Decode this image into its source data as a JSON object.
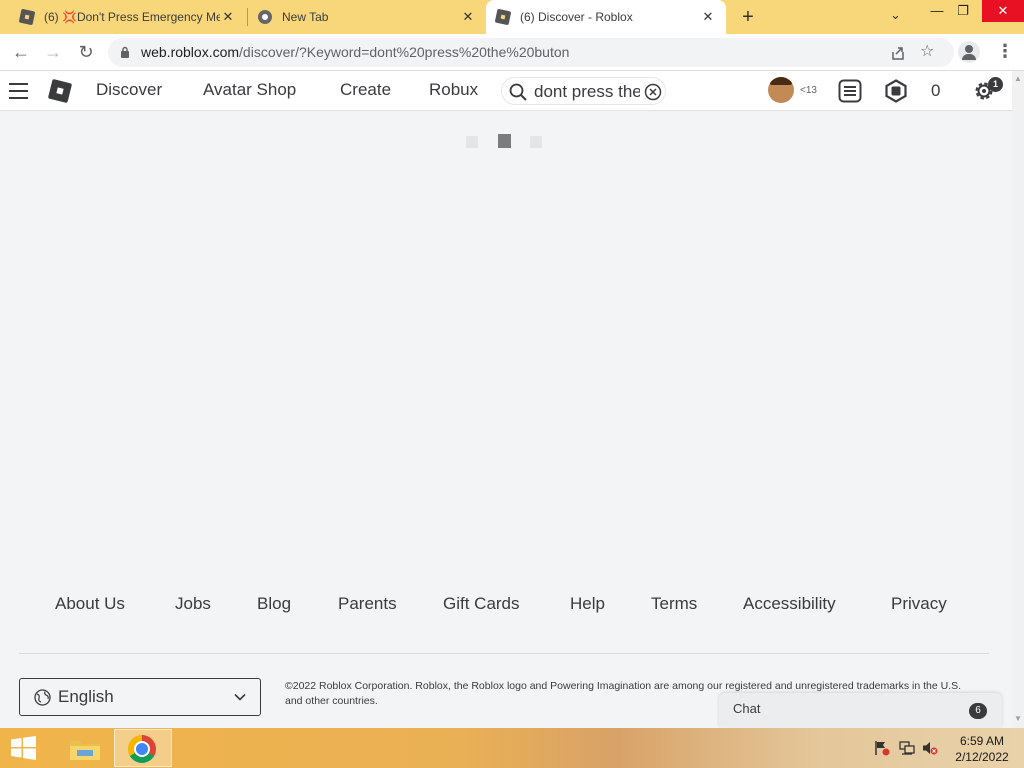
{
  "browser": {
    "tabs": [
      {
        "title": "(6) 💢Don't Press Emergency Me",
        "icon": "roblox-favicon"
      },
      {
        "title": "New Tab",
        "icon": "chrome-favicon"
      },
      {
        "title": "(6) Discover - Roblox",
        "icon": "roblox-favicon"
      }
    ],
    "active_tab": 2,
    "new_tab_label": "+",
    "url_host": "web.roblox.com",
    "url_path": "/discover/?Keyword=dont%20press%20the%20buton"
  },
  "header": {
    "nav": [
      {
        "label": "Discover"
      },
      {
        "label": "Avatar Shop"
      },
      {
        "label": "Create"
      },
      {
        "label": "Robux"
      }
    ],
    "search_value": "dont press the buton",
    "age_label": "<13",
    "robux_count": "0",
    "settings_badge": "1"
  },
  "footer": {
    "links": [
      {
        "label": "About Us"
      },
      {
        "label": "Jobs"
      },
      {
        "label": "Blog"
      },
      {
        "label": "Parents"
      },
      {
        "label": "Gift Cards"
      },
      {
        "label": "Help"
      },
      {
        "label": "Terms"
      },
      {
        "label": "Accessibility"
      },
      {
        "label": "Privacy"
      }
    ],
    "language": "English",
    "copyright": "©2022 Roblox Corporation. Roblox, the Roblox logo and Powering Imagination are among our registered and unregistered trademarks in the U.S. and other countries."
  },
  "chat": {
    "label": "Chat",
    "count": "6"
  },
  "taskbar": {
    "time": "6:59 AM",
    "date": "2/12/2022"
  },
  "colors": {
    "tab_strip": "#f8d77a",
    "page_background": "#f2f4f5",
    "text": "#393b3d",
    "close_button": "#e81123"
  }
}
